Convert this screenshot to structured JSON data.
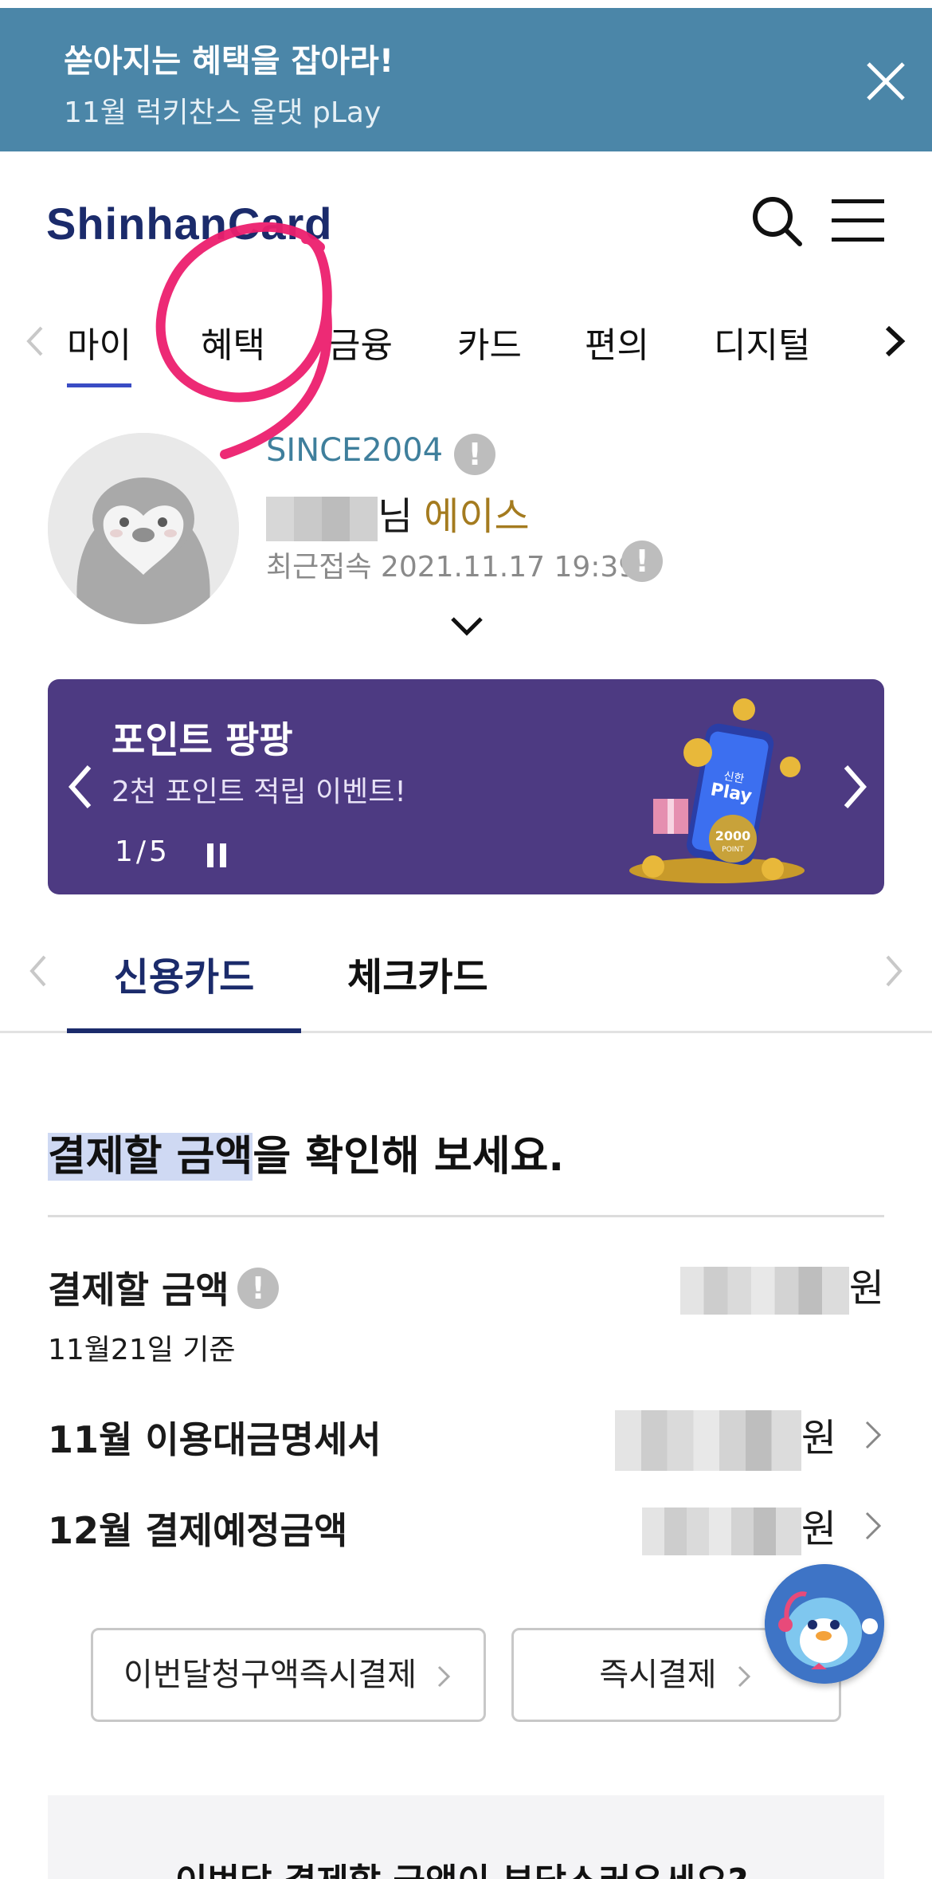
{
  "promo_banner": {
    "title": "쏟아지는 혜택을 잡아라!",
    "subtitle": "11월 럭키찬스 올댓 pLay"
  },
  "header": {
    "logo": "ShinhanCard"
  },
  "gnb": {
    "tabs": [
      "마이",
      "혜택",
      "금융",
      "카드",
      "편의",
      "디지털"
    ],
    "active_tab": "마이"
  },
  "profile": {
    "since": "SINCE2004",
    "name_suffix": "님",
    "grade": "에이스",
    "last_login": "최근접속 2021.11.17 19:39"
  },
  "event_banner": {
    "title": "포인트 팡팡",
    "subtitle": "2천 포인트 적립 이벤트!",
    "page": "1/5",
    "art_brand": "신한",
    "art_play": "Play",
    "art_amount": "2000",
    "art_unit": "POINT"
  },
  "card_tabs": {
    "items": [
      "신용카드",
      "체크카드"
    ],
    "active": "신용카드"
  },
  "payment": {
    "heading_highlight": "결제할 금액",
    "heading_rest": "을 확인해 보세요.",
    "amount_label": "결제할 금액",
    "date_basis": "11월21일 기준",
    "currency": "원",
    "rows": [
      {
        "label": "11월 이용대금명세서",
        "currency": "원"
      },
      {
        "label": "12월 결제예정금액",
        "currency": "원"
      }
    ]
  },
  "actions": {
    "pay_this_month": "이번달청구액즉시결제",
    "pay_now": "즉시결제"
  },
  "bottom": {
    "question": "이번달 결제할 금액이 부담스러우세요?"
  },
  "colors": {
    "promo_bg": "#4b86a8",
    "brand_navy": "#1b2b6b",
    "banner_purple": "#4d3a82",
    "grade_gold": "#a47b1f",
    "annotation_pink": "#ec1f6e"
  }
}
